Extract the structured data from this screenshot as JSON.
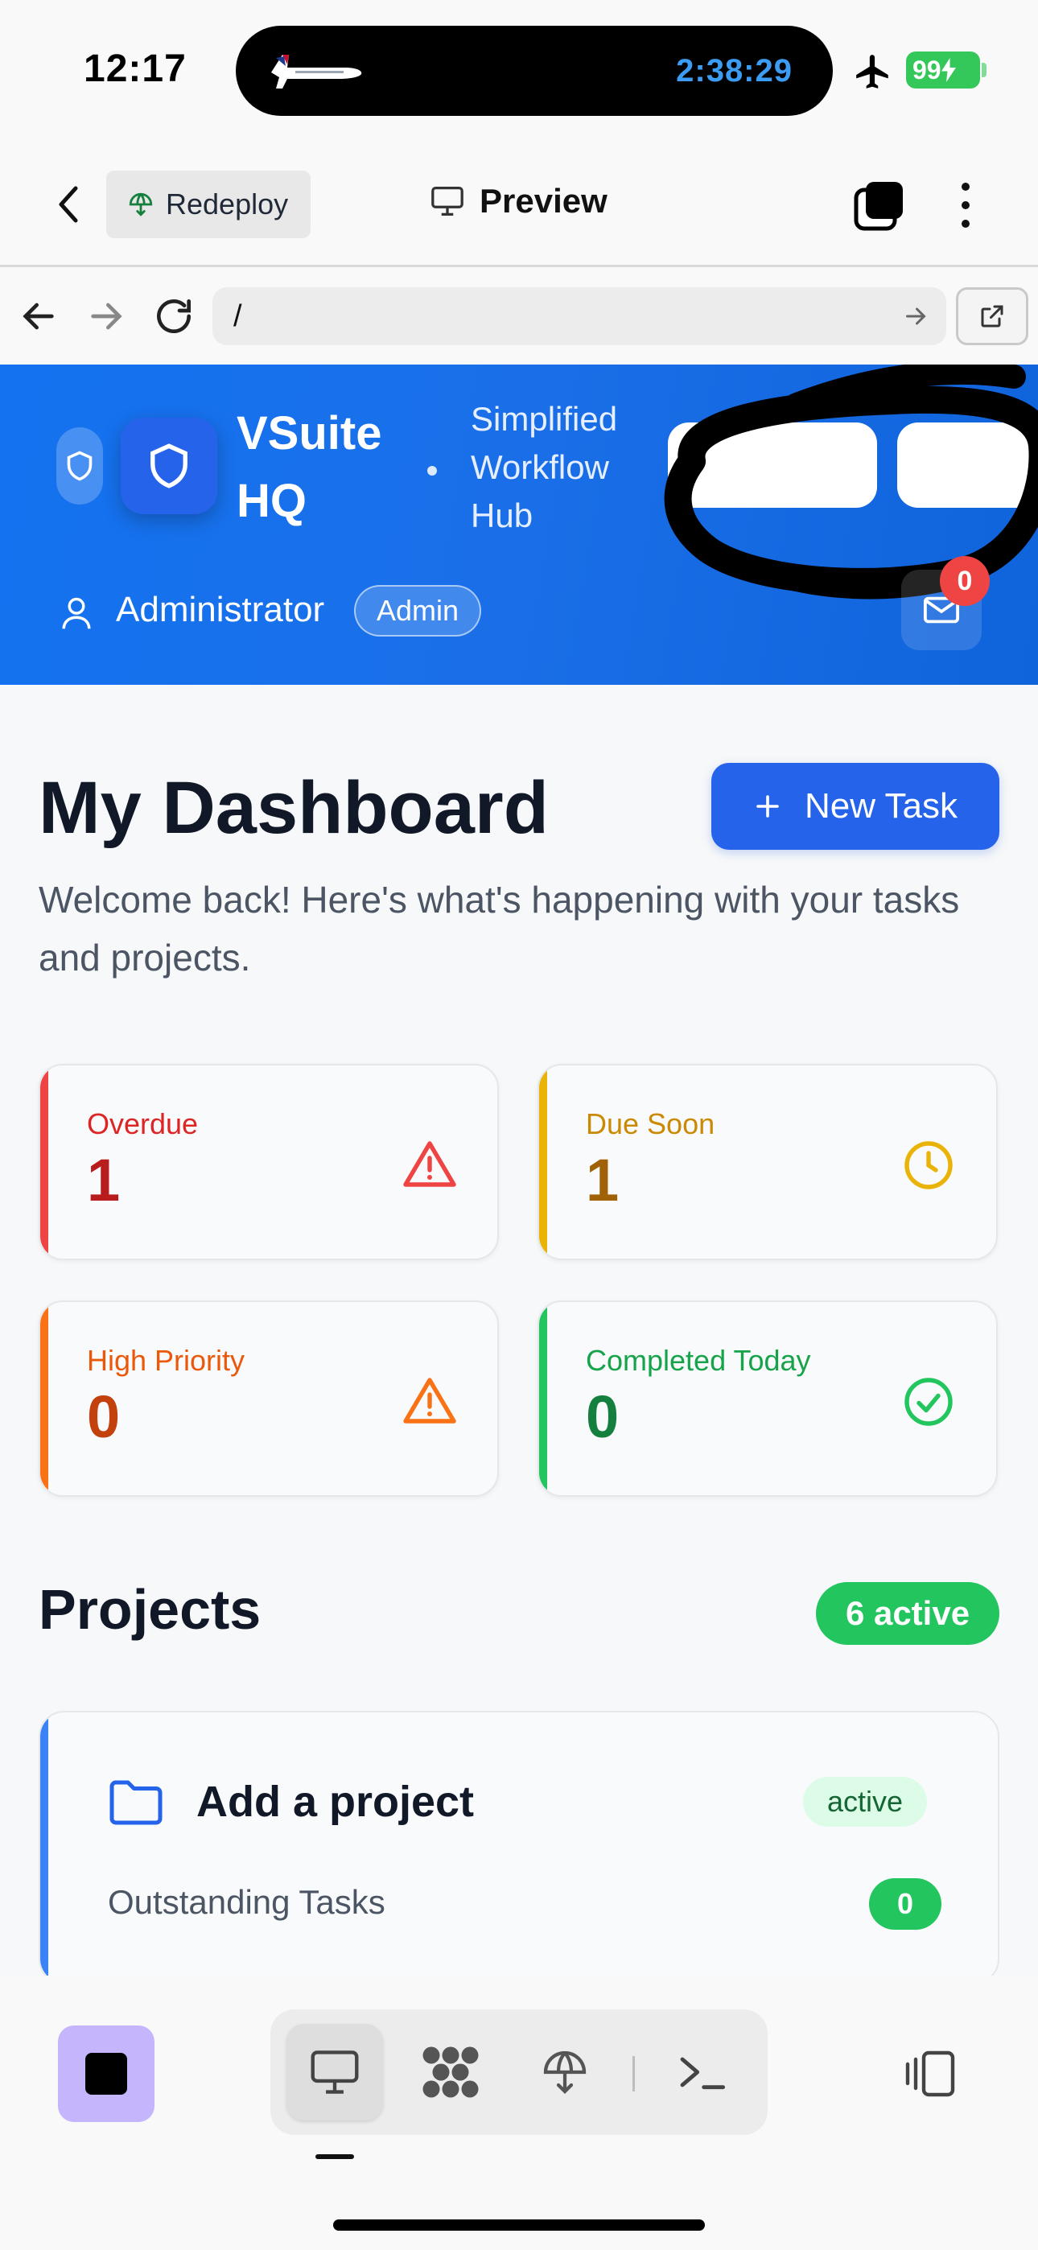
{
  "status_bar": {
    "time": "12:17",
    "timer": "2:38:29",
    "battery": "99"
  },
  "toolbar": {
    "redeploy_label": "Redeploy",
    "preview_label": "Preview"
  },
  "url_bar": {
    "url": "/"
  },
  "header": {
    "brand_line1": "VSuite",
    "brand_line2": "HQ",
    "tagline_line1": "Simplified",
    "tagline_line2": "Workflow",
    "tagline_line3": "Hub",
    "user_name": "Administrator",
    "role": "Admin",
    "notifications": "0"
  },
  "dashboard": {
    "title": "My Dashboard",
    "new_task_label": "New Task",
    "welcome": "Welcome back! Here's what's happening with your tasks and projects.",
    "stats": [
      {
        "label": "Overdue",
        "value": "1",
        "color": "#dc2626",
        "icon": "alert-triangle-icon"
      },
      {
        "label": "Due Soon",
        "value": "1",
        "color": "#ca8a04",
        "icon": "clock-icon"
      },
      {
        "label": "High Priority",
        "value": "0",
        "color": "#ea580c",
        "icon": "alert-triangle-icon"
      },
      {
        "label": "Completed Today",
        "value": "0",
        "color": "#16a34a",
        "icon": "check-circle-icon"
      }
    ]
  },
  "projects": {
    "title": "Projects",
    "active_count": "6 active",
    "items": [
      {
        "name": "Add a project",
        "status": "active",
        "outstanding_label": "Outstanding Tasks",
        "outstanding_count": "0"
      }
    ]
  },
  "dock": {
    "tabs": [
      "preview",
      "apps",
      "deploy",
      "terminal"
    ],
    "selected": "preview"
  },
  "colors": {
    "accent": "#2563eb",
    "success": "#22c55e",
    "danger": "#ef4444",
    "stop_button": "#c4b5fd"
  }
}
